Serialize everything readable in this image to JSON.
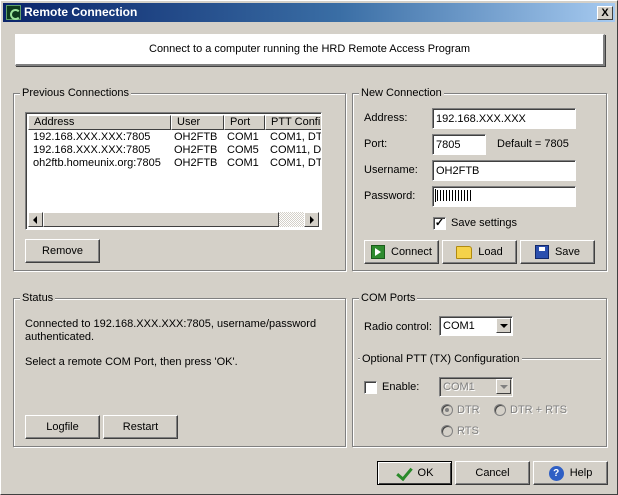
{
  "window": {
    "title": "Remote Connection",
    "close_glyph": "X"
  },
  "banner": {
    "text": "Connect to a computer running the HRD Remote Access Program"
  },
  "previous_connections": {
    "legend": "Previous Connections",
    "columns": [
      "Address",
      "User",
      "Port",
      "PTT Confi"
    ],
    "rows": [
      {
        "address": "192.168.XXX.XXX:7805",
        "user": "OH2FTB",
        "port": "COM1",
        "ptt": "COM1, DT"
      },
      {
        "address": "192.168.XXX.XXX:7805",
        "user": "OH2FTB",
        "port": "COM5",
        "ptt": "COM11, D"
      },
      {
        "address": "oh2ftb.homeunix.org:7805",
        "user": "OH2FTB",
        "port": "COM1",
        "ptt": "COM1, DT"
      }
    ],
    "remove_label": "Remove"
  },
  "new_connection": {
    "legend": "New Connection",
    "address_label": "Address:",
    "address_value": "192.168.XXX.XXX",
    "port_label": "Port:",
    "port_value": "7805",
    "port_default": "Default = 7805",
    "username_label": "Username:",
    "username_value": "OH2FTB",
    "password_label": "Password:",
    "save_settings_label": "Save settings",
    "save_settings_checked": true,
    "save_settings_glyph": "✓",
    "connect_label": "Connect",
    "load_label": "Load",
    "save_label": "Save"
  },
  "status": {
    "legend": "Status",
    "line1": "Connected to 192.168.XXX.XXX:7805, username/password",
    "line2": "authenticated.",
    "line3": "Select a remote COM Port, then press 'OK'.",
    "logfile_label": "Logfile",
    "restart_label": "Restart"
  },
  "com_ports": {
    "legend": "COM Ports",
    "radio_control_label": "Radio control:",
    "radio_control_value": "COM1",
    "ptt_legend": "Optional PTT (TX) Configuration",
    "enable_label": "Enable:",
    "enable_checked": false,
    "ptt_port_value": "COM1",
    "dtr_label": "DTR",
    "dtr_rts_label": "DTR + RTS",
    "rts_label": "RTS"
  },
  "footer": {
    "ok_label": "OK",
    "cancel_label": "Cancel",
    "help_label": "Help",
    "help_glyph": "?"
  }
}
